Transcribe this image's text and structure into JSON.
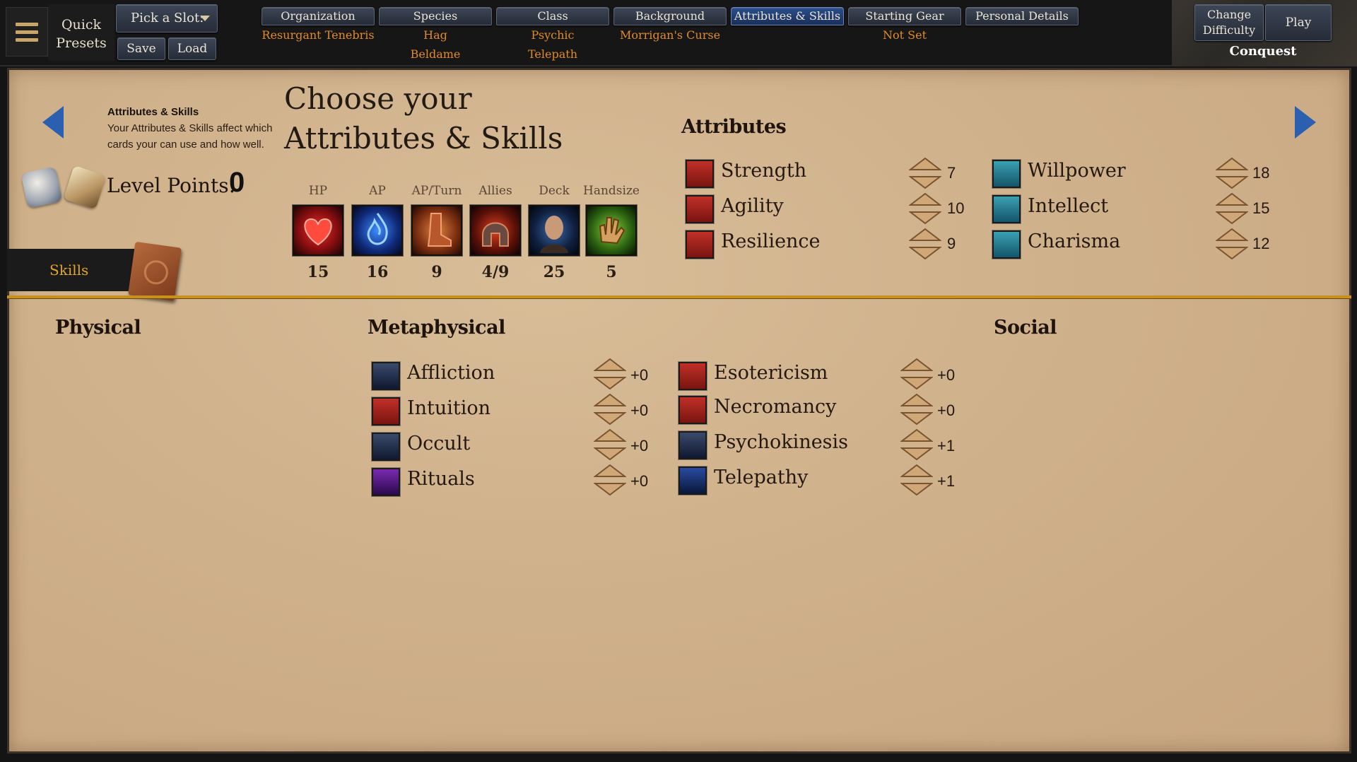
{
  "topbar": {
    "quick_presets": "Quick\nPresets",
    "slot_select": "Pick a Slot:",
    "save": "Save",
    "load": "Load",
    "tabs": [
      {
        "label": "Organization",
        "values": [
          "Resurgant Tenebris"
        ]
      },
      {
        "label": "Species",
        "values": [
          "Hag",
          "Beldame"
        ]
      },
      {
        "label": "Class",
        "values": [
          "Psychic",
          "Telepath"
        ]
      },
      {
        "label": "Background",
        "values": [
          "Morrigan's Curse"
        ]
      },
      {
        "label": "Attributes & Skills",
        "values": [],
        "active": true
      },
      {
        "label": "Starting Gear",
        "values": [
          "Not Set"
        ]
      },
      {
        "label": "Personal Details",
        "values": []
      }
    ],
    "change_difficulty": "Change Difficulty",
    "play": "Play",
    "difficulty": "Conquest"
  },
  "header": {
    "info_title": "Attributes & Skills",
    "info_text": "Your Attributes & Skills affect which cards your can use and how well.",
    "title_line1": "Choose your",
    "title_line2": "Attributes & Skills",
    "level_points_label": "Level Points:",
    "level_points": "0"
  },
  "stats": [
    {
      "label": "HP",
      "value": "15",
      "icon": "heart-icon"
    },
    {
      "label": "AP",
      "value": "16",
      "icon": "ap-flame-icon"
    },
    {
      "label": "AP/Turn",
      "value": "9",
      "icon": "boot-icon"
    },
    {
      "label": "Allies",
      "value": "4/9",
      "icon": "helmet-icon"
    },
    {
      "label": "Deck",
      "value": "25",
      "icon": "face-icon"
    },
    {
      "label": "Handsize",
      "value": "5",
      "icon": "hand-icon"
    }
  ],
  "attributes": {
    "heading": "Attributes",
    "left": [
      {
        "name": "Strength",
        "value": "7",
        "icon": "strength-icon"
      },
      {
        "name": "Agility",
        "value": "10",
        "icon": "agility-icon"
      },
      {
        "name": "Resilience",
        "value": "9",
        "icon": "resilience-icon"
      }
    ],
    "right": [
      {
        "name": "Willpower",
        "value": "18",
        "icon": "willpower-icon"
      },
      {
        "name": "Intellect",
        "value": "15",
        "icon": "intellect-icon"
      },
      {
        "name": "Charisma",
        "value": "12",
        "icon": "charisma-icon"
      }
    ]
  },
  "skills_tab": "Skills",
  "skills": {
    "physical": {
      "heading": "Physical",
      "items": []
    },
    "metaphysical": {
      "heading": "Metaphysical",
      "left": [
        {
          "name": "Affliction",
          "value": "+0",
          "icon": "affliction-icon"
        },
        {
          "name": "Intuition",
          "value": "+0",
          "icon": "intuition-icon"
        },
        {
          "name": "Occult",
          "value": "+0",
          "icon": "occult-icon"
        },
        {
          "name": "Rituals",
          "value": "+0",
          "icon": "rituals-icon"
        }
      ],
      "right": [
        {
          "name": "Esotericism",
          "value": "+0",
          "icon": "esotericism-icon"
        },
        {
          "name": "Necromancy",
          "value": "+0",
          "icon": "necromancy-icon"
        },
        {
          "name": "Psychokinesis",
          "value": "+1",
          "icon": "psychokinesis-icon"
        },
        {
          "name": "Telepathy",
          "value": "+1",
          "icon": "telepathy-icon"
        }
      ]
    },
    "social": {
      "heading": "Social",
      "items": []
    }
  },
  "colors": {
    "accent_orange": "#e18a2a",
    "tab_blue": "#2b4e8c",
    "divider_gold": "#c7901f"
  }
}
